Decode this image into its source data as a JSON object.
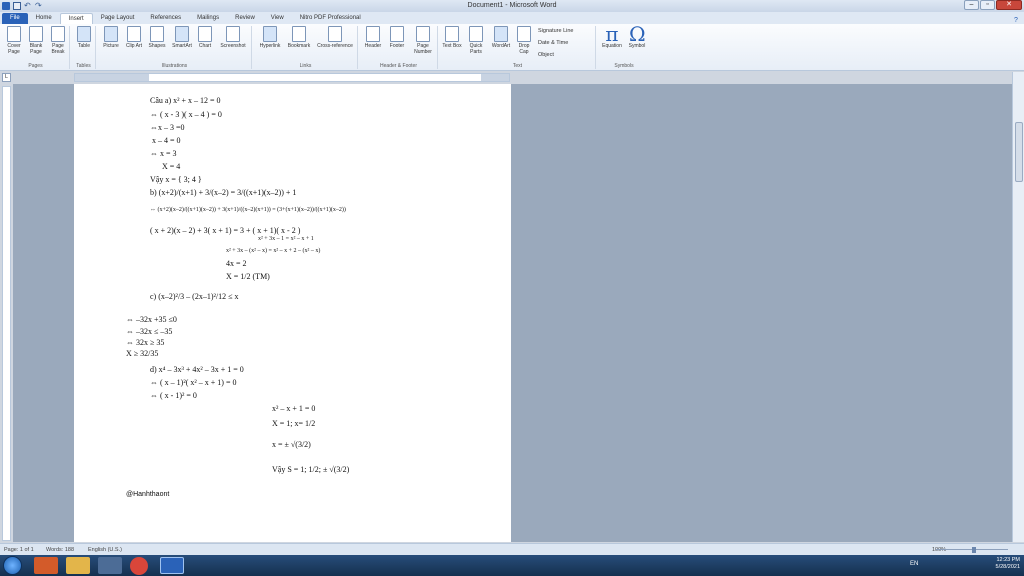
{
  "window": {
    "title": "Document1 - Microsoft Word"
  },
  "tabs": [
    "File",
    "Home",
    "Insert",
    "Page Layout",
    "References",
    "Mailings",
    "Review",
    "View",
    "Nitro PDF Professional"
  ],
  "ribbon": {
    "pages": {
      "label": "Pages",
      "cover": "Cover Page",
      "blank": "Blank Page",
      "break": "Page Break"
    },
    "tables": {
      "label": "Tables",
      "table": "Table"
    },
    "illustrations": {
      "label": "Illustrations",
      "picture": "Picture",
      "clipart": "Clip Art",
      "shapes": "Shapes",
      "smartart": "SmartArt",
      "chart": "Chart",
      "screenshot": "Screenshot"
    },
    "links": {
      "label": "Links",
      "hyperlink": "Hyperlink",
      "bookmark": "Bookmark",
      "crossref": "Cross-reference"
    },
    "headerfooter": {
      "label": "Header & Footer",
      "header": "Header",
      "footer": "Footer",
      "pagenumber": "Page Number"
    },
    "text": {
      "label": "Text",
      "textbox": "Text Box",
      "quickparts": "Quick Parts",
      "wordart": "WordArt",
      "dropcap": "Drop Cap",
      "signature": "Signature Line",
      "datetime": "Date & Time",
      "object": "Object"
    },
    "symbols": {
      "label": "Symbols",
      "equation": "Equation",
      "symbol": "Symbol"
    }
  },
  "document": {
    "lines": [
      "Câu a) x² + x – 12 = 0",
      "⇔ ( x - 3 )( x – 4 ) = 0",
      "⇔x – 3 =0",
      "x – 4 = 0",
      "⇔ x = 3",
      "X = 4",
      "Vậy x = { 3; 4 }",
      "b) (x+2)/(x+1) + 3/(x–2) = 3/((x+1)(x–2)) + 1",
      "⇔ (x+2)(x–2)/((x+1)(x–2)) + 3(x+1)/((x–2)(x+1)) = (3+(x+1)(x–2))/((x+1)(x–2))",
      "( x + 2)(x – 2) + 3( x + 1) = 3 + ( x + 1)( x - 2 )",
      "x² + 3x – 1 = x² – x + 1",
      "x² + 3x – (x² – x) = x² – x + 2 – (x² – x)",
      "4x = 2",
      "X = 1/2 (TM)",
      "c) (x–2)²/3 – (2x–1)²/12 ≤ x",
      "⇔ –32x +35 ≤0",
      "⇔ –32x ≤ –35",
      "⇔ 32x ≥ 35",
      "X ≥ 32/35",
      "d) x⁴ – 3x³ + 4x² – 3x + 1 = 0",
      "⇔ ( x – 1)²( x² – x + 1) = 0",
      "⇔ ( x - 1)² = 0",
      "x² – x + 1 = 0",
      "X = 1; x= 1/2",
      "x = ± √(3/2)",
      "Vậy S = 1; 1/2; ± √(3/2)",
      "@Hanhthaont"
    ]
  },
  "statusbar": {
    "page": "Page: 1 of 1",
    "words": "Words: 188",
    "lang": "English (U.S.)",
    "zoom": "100%"
  },
  "taskbar": {
    "lang": "EN",
    "time": "12:23 PM",
    "date": "5/28/2021"
  }
}
